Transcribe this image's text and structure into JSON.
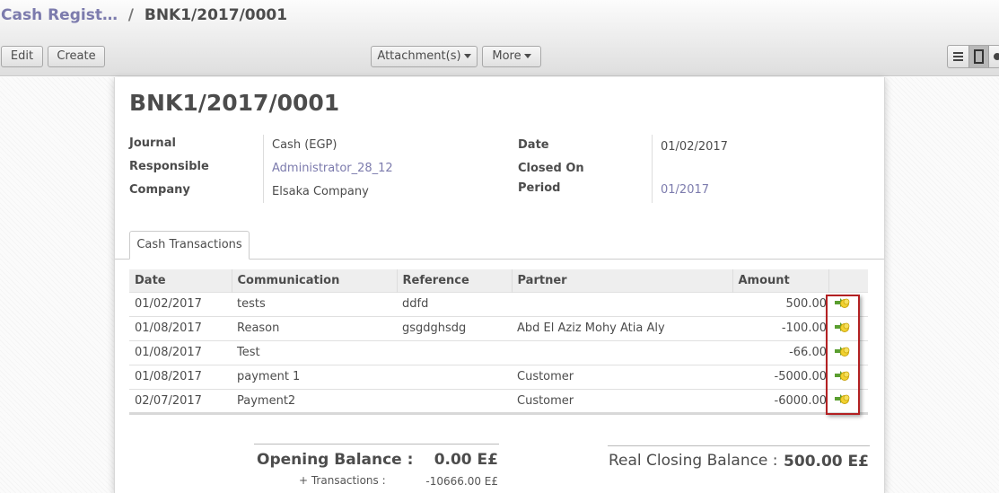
{
  "breadcrumb": {
    "parent": "Cash Regist…",
    "separator": "/",
    "current": "BNK1/2017/0001"
  },
  "toolbar": {
    "edit": "Edit",
    "create": "Create",
    "attachments": "Attachment(s)",
    "more": "More"
  },
  "view_switcher": [
    "list-view-icon",
    "form-view-icon",
    "third-view-icon"
  ],
  "record": {
    "title": "BNK1/2017/0001",
    "left_fields": [
      {
        "label": "Journal",
        "value": "Cash (EGP)"
      },
      {
        "label": "Responsible",
        "value": "Administrator_28_12"
      },
      {
        "label": "Company",
        "value": "Elsaka Company"
      }
    ],
    "right_fields": [
      {
        "label": "Date",
        "value": "01/02/2017"
      },
      {
        "label": "Closed On",
        "value": ""
      },
      {
        "label": "Period",
        "value": "01/2017"
      }
    ]
  },
  "tabs": [
    "Cash Transactions"
  ],
  "transactions": {
    "columns": [
      "Date",
      "Communication",
      "Reference",
      "Partner",
      "Amount"
    ],
    "rows": [
      {
        "date": "01/02/2017",
        "communication": "tests",
        "reference": "ddfd",
        "partner": "",
        "amount": "500.00"
      },
      {
        "date": "01/08/2017",
        "communication": "Reason",
        "reference": "gsgdghsdg",
        "partner": "Abd El Aziz Mohy Atia Aly",
        "amount": "-100.00"
      },
      {
        "date": "01/08/2017",
        "communication": "Test",
        "reference": "",
        "partner": "",
        "amount": "-66.00"
      },
      {
        "date": "01/08/2017",
        "communication": "payment 1",
        "reference": "",
        "partner": "Customer",
        "amount": "-5000.00"
      },
      {
        "date": "02/07/2017",
        "communication": "Payment2",
        "reference": "",
        "partner": "Customer",
        "amount": "-6000.00"
      }
    ],
    "row_icon": "move-arrow-coins-icon"
  },
  "balances": {
    "opening_label": "Opening Balance :",
    "opening_value": "0.00 E£",
    "transactions_label": "+ Transactions :",
    "transactions_value": "-10666.00 E£",
    "closing_label": "Real Closing Balance :",
    "closing_value": "500.00 E£"
  },
  "colors": {
    "link": "#7c7bad",
    "highlight_box": "#b32022",
    "header_bg": "#eeeeee"
  }
}
